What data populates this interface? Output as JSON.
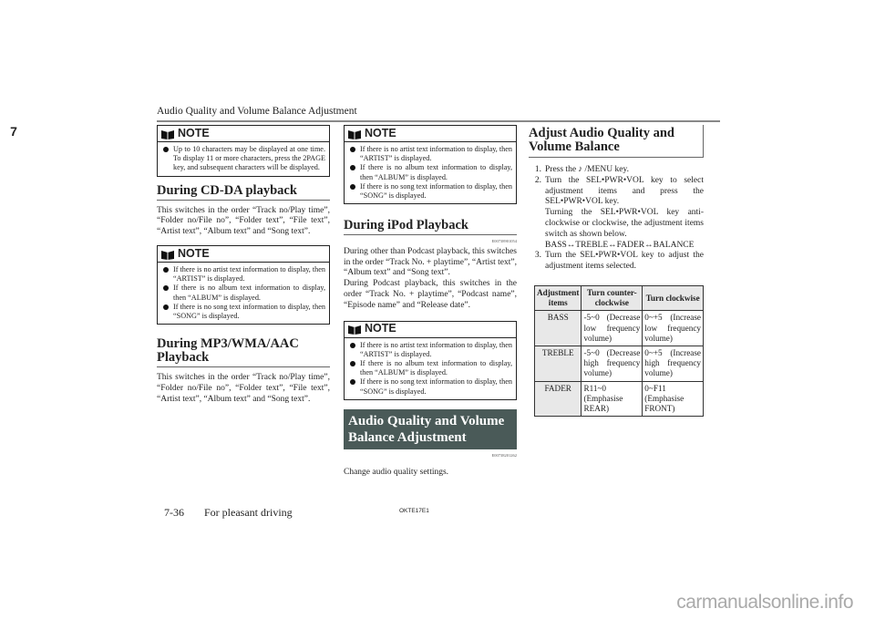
{
  "header": {
    "running_title": "Audio Quality and Volume Balance Adjustment",
    "chapter_tab": "7"
  },
  "col1": {
    "note1": {
      "label": "NOTE",
      "items": [
        "Up to 10 characters may be displayed at one time. To display 11 or more characters, press the 2PAGE key, and subsequent characters will be displayed."
      ]
    },
    "cdda": {
      "title": "During CD-DA playback",
      "body": "This switches in the order “Track no/Play time”, “Folder no/File no”, “Folder text”, “File text”, “Artist text”, “Album text” and “Song text”."
    },
    "note2": {
      "label": "NOTE",
      "items": [
        "If there is no artist text information to display, then “ARTIST” is displayed.",
        "If there is no album text information to display, then “ALBUM” is displayed.",
        "If there is no song text information to display, then “SONG” is displayed."
      ]
    },
    "mp3": {
      "title": "During MP3/WMA/AAC Playback",
      "body": "This switches in the order “Track no/Play time”, “Folder no/File no”, “Folder text”, “File text”, “Artist text”, “Album text” and “Song text”."
    }
  },
  "col2": {
    "note1": {
      "label": "NOTE",
      "items": [
        "If there is no artist text information to display, then “ARTIST” is displayed.",
        "If there is no album text information to display, then “ALBUM” is displayed.",
        "If there is no song text information to display, then “SONG” is displayed."
      ]
    },
    "ipod": {
      "title": "During iPod Playback",
      "code": "E00738901054",
      "body1": "During other than Podcast playback, this switches in the order “Track No. + playtime”, “Artist text”, “Album text” and “Song text”.",
      "body2": "During Podcast playback, this switches in the order “Track No. + playtime”, “Podcast name”, “Episode name” and “Release date”."
    },
    "note2": {
      "label": "NOTE",
      "items": [
        "If there is no artist text information to display, then “ARTIST” is displayed.",
        "If there is no album text information to display, then “ALBUM” is displayed.",
        "If there is no song text information to display, then “SONG” is displayed."
      ]
    },
    "aqvb": {
      "title": "Audio Quality and Volume Balance Adjustment",
      "code": "E00738201262",
      "body": "Change audio quality settings."
    }
  },
  "col3": {
    "title": "Adjust Audio Quality and Volume Balance",
    "steps": [
      {
        "n": "1.",
        "pre": "Press the",
        "icon": "music-note-icon",
        "post": "/MENU key."
      },
      {
        "n": "2.",
        "text": "Turn the SEL•PWR•VOL key to select adjustment items and press the SEL•PWR•VOL key."
      },
      {
        "n": "",
        "text": "Turning the SEL•PWR•VOL key anti-clockwise or clockwise, the adjustment items switch as shown below."
      },
      {
        "n": "",
        "text": "BASS↔TREBLE↔FADER↔BALANCE"
      },
      {
        "n": "3.",
        "text": "Turn the SEL•PWR•VOL key to adjust the adjustment items selected."
      }
    ],
    "table": {
      "headers": [
        "Adjustment items",
        "Turn counter-clockwise",
        "Turn clockwise"
      ],
      "rows": [
        [
          "BASS",
          "-5~0 (Decrease low frequency volume)",
          "0~+5 (Increase low frequency volume)"
        ],
        [
          "TREBLE",
          "-5~0 (Decrease high frequency volume)",
          "0~+5 (Increase high frequency volume)"
        ],
        [
          "FADER",
          "R11~0 (Emphasise REAR)",
          "0~F11 (Emphasise FRONT)"
        ]
      ]
    }
  },
  "footer": {
    "page": "7-36",
    "section": "For pleasant driving",
    "code": "OKTE17E1"
  },
  "watermark": "carmanualsonline.info"
}
